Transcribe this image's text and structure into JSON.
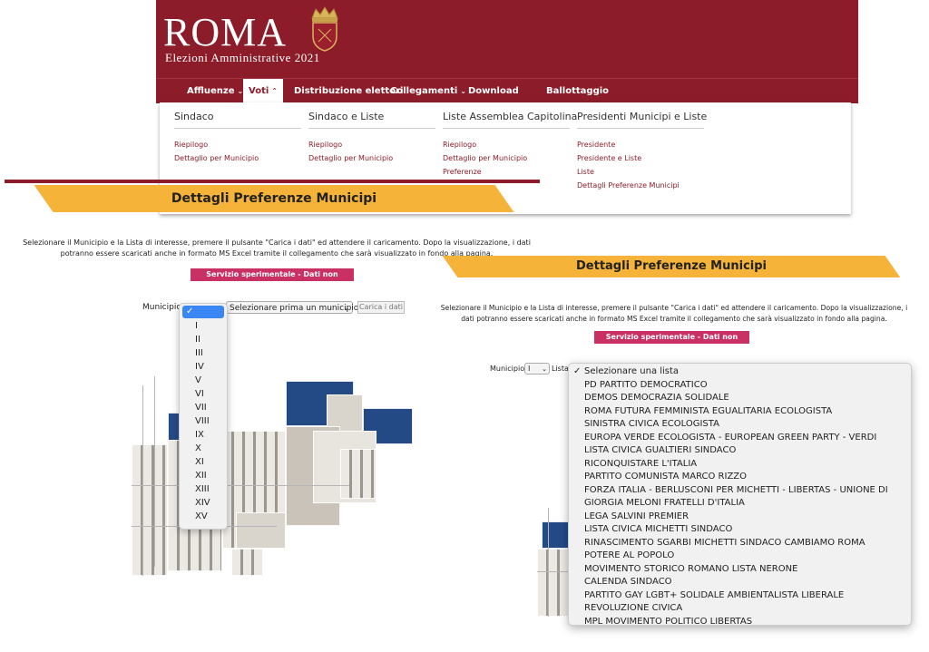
{
  "header": {
    "title": "ROMA",
    "subtitle": "Elezioni Amministrative 2021",
    "crest_icon": "rome-crest-icon",
    "colors": {
      "header_bg": "#8c1c29",
      "accent_banner": "#f5b33a",
      "pill": "#c93063",
      "link": "#8c1c29",
      "select_highlight": "#3a86f5"
    }
  },
  "nav": {
    "items": [
      {
        "label": "Affluenze",
        "chevron": "⌄"
      },
      {
        "label": "Voti",
        "chevron": "⌃"
      },
      {
        "label": "Distribuzione elettori",
        "chevron": ""
      },
      {
        "label": "Collegamenti",
        "chevron": "⌄"
      },
      {
        "label": "Download",
        "chevron": ""
      },
      {
        "label": "Ballottaggio",
        "chevron": ""
      }
    ]
  },
  "mega_menu": {
    "columns": [
      {
        "heading": "Sindaco",
        "links": [
          "Riepilogo",
          "Dettaglio per Municipio"
        ]
      },
      {
        "heading": "Sindaco e Liste",
        "links": [
          "Riepilogo",
          "Dettaglio per Municipio"
        ]
      },
      {
        "heading": "Liste Assemblea Capitolina",
        "links": [
          "Riepilogo",
          "Dettaglio per Municipio",
          "Preferenze"
        ]
      },
      {
        "heading": "Presidenti Municipi e Liste",
        "links": [
          "Presidente",
          "Presidente e Liste",
          "Liste",
          "Dettagli Preferenze Municipi"
        ]
      }
    ]
  },
  "left_page": {
    "banner_title": "Dettagli Preferenze Municipi",
    "intro": "Selezionare il Municipio e la Lista di interesse, premere il pulsante \"Carica i dati\" ed attendere il caricamento. Dopo la visualizzazione, i dati potranno essere scaricati anche in formato MS Excel tramite il collegamento che sarà visualizzato in fondo alla pagina.",
    "notice": "Servizio sperimentale - Dati non ufficiali",
    "municipio_label": "Municipio",
    "municipio_selected": "✓",
    "municipio_options": [
      "I",
      "II",
      "III",
      "IV",
      "V",
      "VI",
      "VII",
      "VIII",
      "IX",
      "X",
      "XI",
      "XII",
      "XIII",
      "XIV",
      "XV"
    ],
    "lista_select_value": "Selezionare prima un municipio",
    "load_button": "Carica i dati"
  },
  "right_page": {
    "banner_title": "Dettagli Preferenze Municipi",
    "intro": "Selezionare il Municipio e la Lista di interesse, premere il pulsante \"Carica i dati\" ed attendere il caricamento. Dopo la visualizzazione, i dati potranno essere scaricati anche in formato MS Excel tramite il collegamento che sarà visualizzato in fondo alla pagina.",
    "notice": "Servizio sperimentale - Dati non ufficiali",
    "municipio_label": "Municipio",
    "municipio_value": "I",
    "lista_label": "Lista",
    "lista_options": [
      "Selezionare una lista",
      "PD PARTITO DEMOCRATICO",
      "DEMOS DEMOCRAZIA SOLIDALE",
      "ROMA FUTURA FEMMINISTA EGUALITARIA ECOLOGISTA",
      "SINISTRA CIVICA ECOLOGISTA",
      "EUROPA VERDE ECOLOGISTA - EUROPEAN GREEN PARTY - VERDI",
      "LISTA CIVICA GUALTIERI SINDACO",
      "RICONQUISTARE L'ITALIA",
      "PARTITO COMUNISTA MARCO RIZZO",
      "FORZA ITALIA - BERLUSCONI PER MICHETTI - LIBERTAS - UNIONE DI",
      "GIORGIA MELONI FRATELLI D'ITALIA",
      "LEGA SALVINI PREMIER",
      "LISTA CIVICA MICHETTI SINDACO",
      "RINASCIMENTO SGARBI MICHETTI SINDACO CAMBIAMO ROMA",
      "POTERE AL POPOLO",
      "MOVIMENTO STORICO ROMANO LISTA NERONE",
      "CALENDA SINDACO",
      "PARTITO GAY LGBT+ SOLIDALE AMBIENTALISTA LIBERALE",
      "REVOLUZIONE CIVICA",
      "MPL MOVIMENTO POLITICO LIBERTAS"
    ],
    "lista_selected_index": 0
  }
}
